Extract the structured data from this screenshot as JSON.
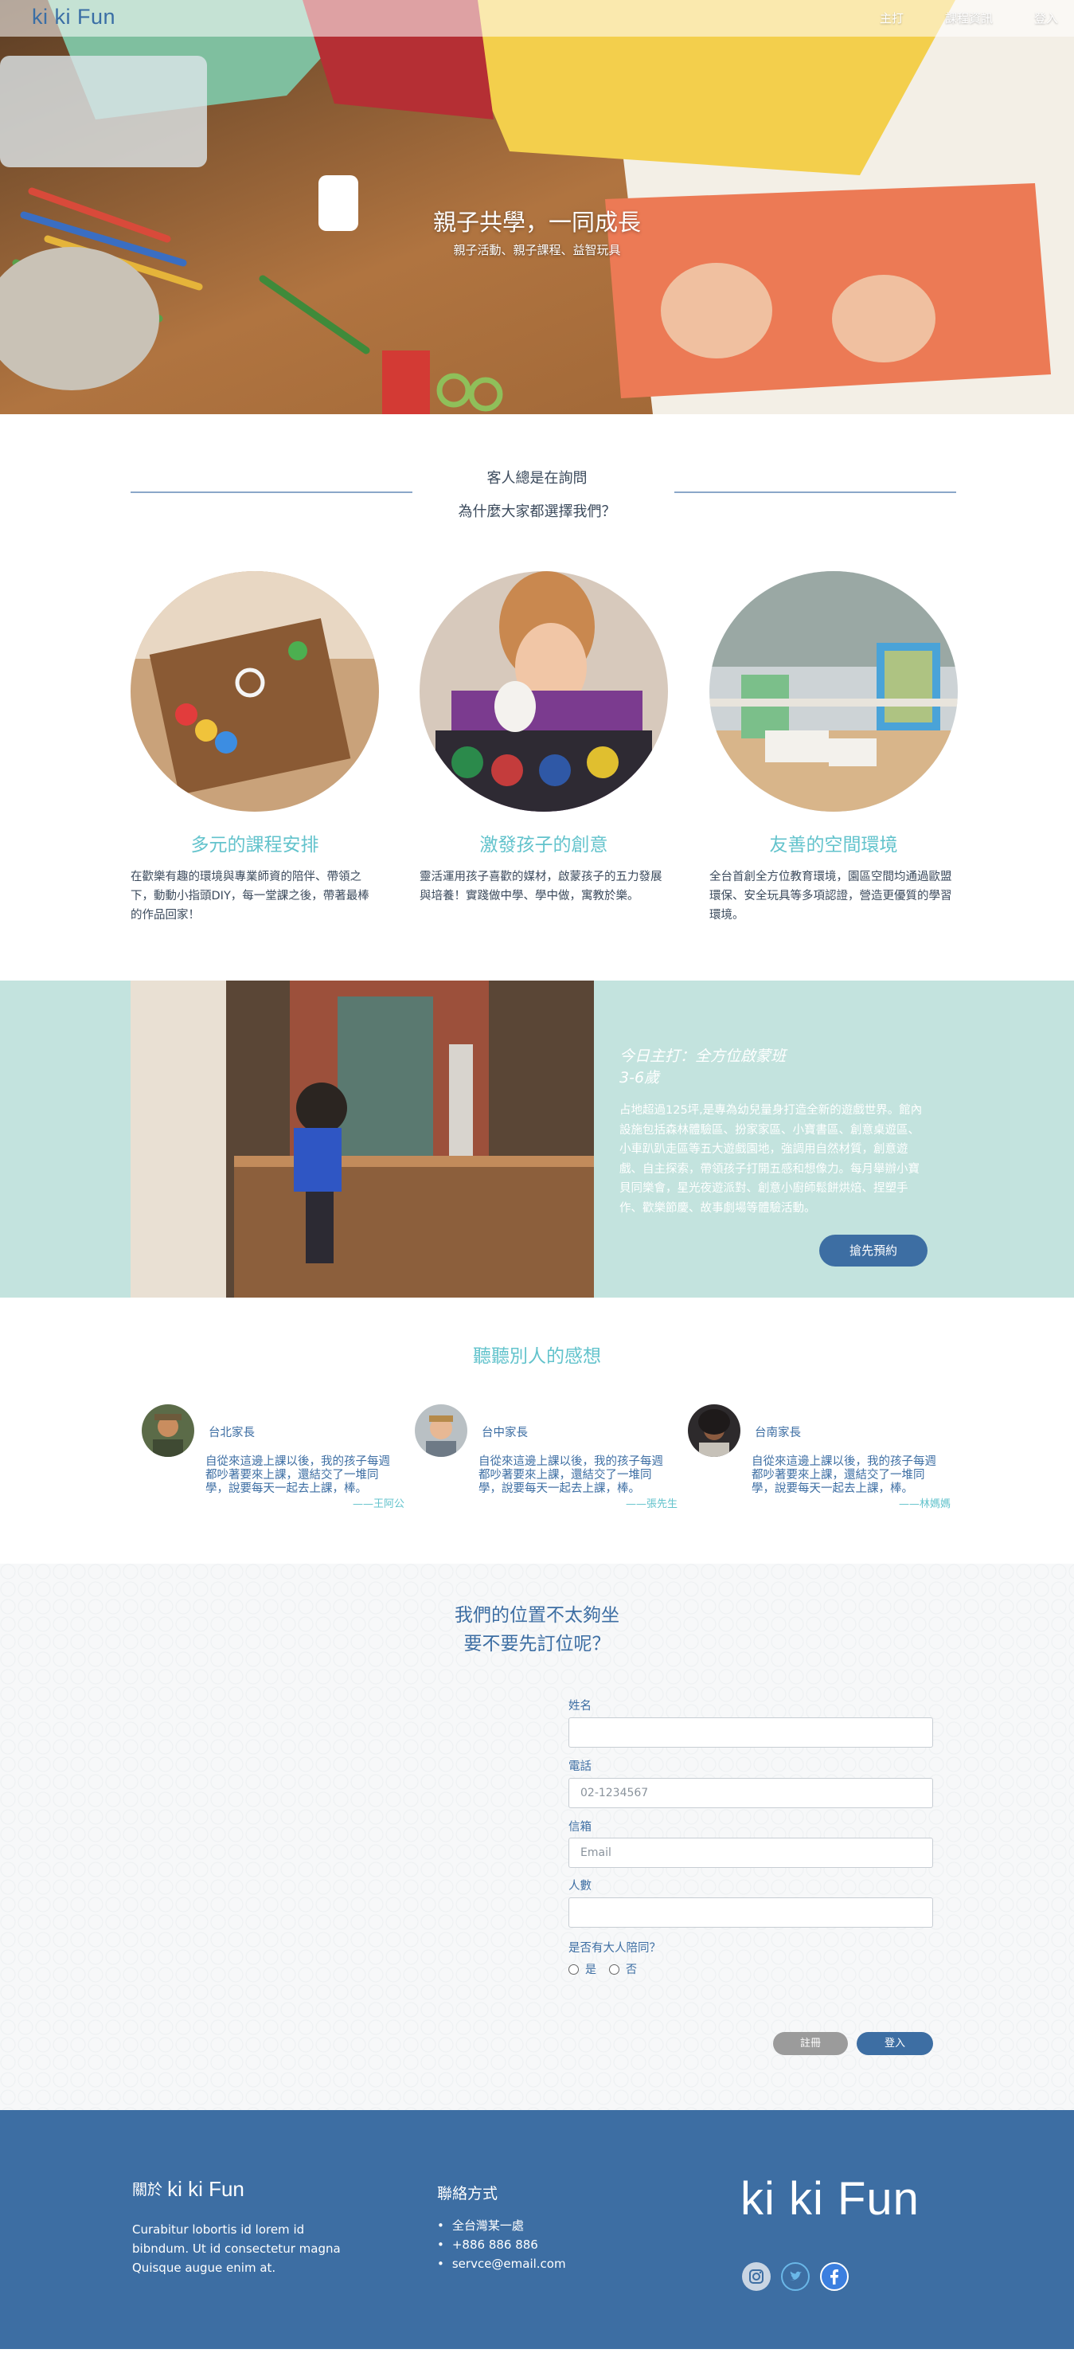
{
  "nav": {
    "logo": "ki ki Fun",
    "links": [
      "主打",
      "課程資訊",
      "登入"
    ]
  },
  "hero": {
    "title": "親子共學，一同成長",
    "subtitle": "親子活動、親子課程、益智玩具"
  },
  "why": {
    "heading": "客人總是在詢問",
    "subheading": "為什麼大家都選擇我們？",
    "features": [
      {
        "title": "多元的課程安排",
        "text": "在歡樂有趣的環境與專業師資的陪伴、帶領之下，動動小指頭DIY，每一堂課之後，帶著最棒的作品回家！"
      },
      {
        "title": "激發孩子的創意",
        "text": "靈活運用孩子喜歡的媒材，啟蒙孩子的五力發展與培養！實踐做中學、學中做，寓教於樂。"
      },
      {
        "title": "友善的空間環境",
        "text": "全台首創全方位教育環境，園區空間均通過歐盟環保、安全玩具等多項認證，營造更優質的學習環境。"
      }
    ]
  },
  "promo": {
    "title_line1": "今日主打：全方位啟蒙班",
    "title_line2": "3-6歲",
    "text": "占地超過125坪,是專為幼兒量身打造全新的遊戲世界。館內設施包括森林體驗區、扮家家區、小寶書區、創意桌遊區、小車趴趴走區等五大遊戲園地，強調用自然材質，創意遊戲、自主探索，帶領孩子打開五感和想像力。每月舉辦小寶貝同樂會，星光夜遊派對、創意小廚師鬆餅烘焙、捏塑手作、歡樂節慶、故事劇場等體驗活動。",
    "button": "搶先預約"
  },
  "testimonials": {
    "heading": "聽聽別人的感想",
    "items": [
      {
        "name": "台北家長",
        "quote": "自從來這邊上課以後，我的孩子每週都吵著要來上課，還結交了一堆同學，說要每天一起去上課，棒。",
        "author": "——王阿公"
      },
      {
        "name": "台中家長",
        "quote": "自從來這邊上課以後，我的孩子每週都吵著要來上課，還結交了一堆同學，說要每天一起去上課，棒。",
        "author": "——張先生"
      },
      {
        "name": "台南家長",
        "quote": "自從來這邊上課以後，我的孩子每週都吵著要來上課，還結交了一堆同學，說要每天一起去上課，棒。",
        "author": "——林媽媽"
      }
    ]
  },
  "booking": {
    "heading_line1": "我們的位置不太夠坐",
    "heading_line2": "要不要先訂位呢？",
    "name_label": "姓名",
    "name_value": "",
    "phone_label": "電話",
    "phone_placeholder": "02-1234567",
    "email_label": "信箱",
    "email_placeholder": "Email",
    "count_label": "人數",
    "count_value": "",
    "adult_question": "是否有大人陪同？",
    "yes": "是",
    "no": "否",
    "register": "註冊",
    "login": "登入"
  },
  "footer": {
    "about_prefix": "關於",
    "about_logo": "ki ki Fun",
    "about_text": "Curabitur lobortis id lorem id bibndum. Ut id consectetur magna Quisque augue enim at.",
    "contact_title": "聯絡方式",
    "contact_items": [
      "全台灣某一處",
      "+886 886 886",
      "servce@email.com"
    ],
    "logo": "ki ki Fun",
    "social_icons": [
      "instagram-icon",
      "twitter-icon",
      "facebook-icon"
    ]
  },
  "colors": {
    "primary": "#3d6ea3",
    "accent": "#63c3cc",
    "promo_bg": "#c3e3de"
  }
}
